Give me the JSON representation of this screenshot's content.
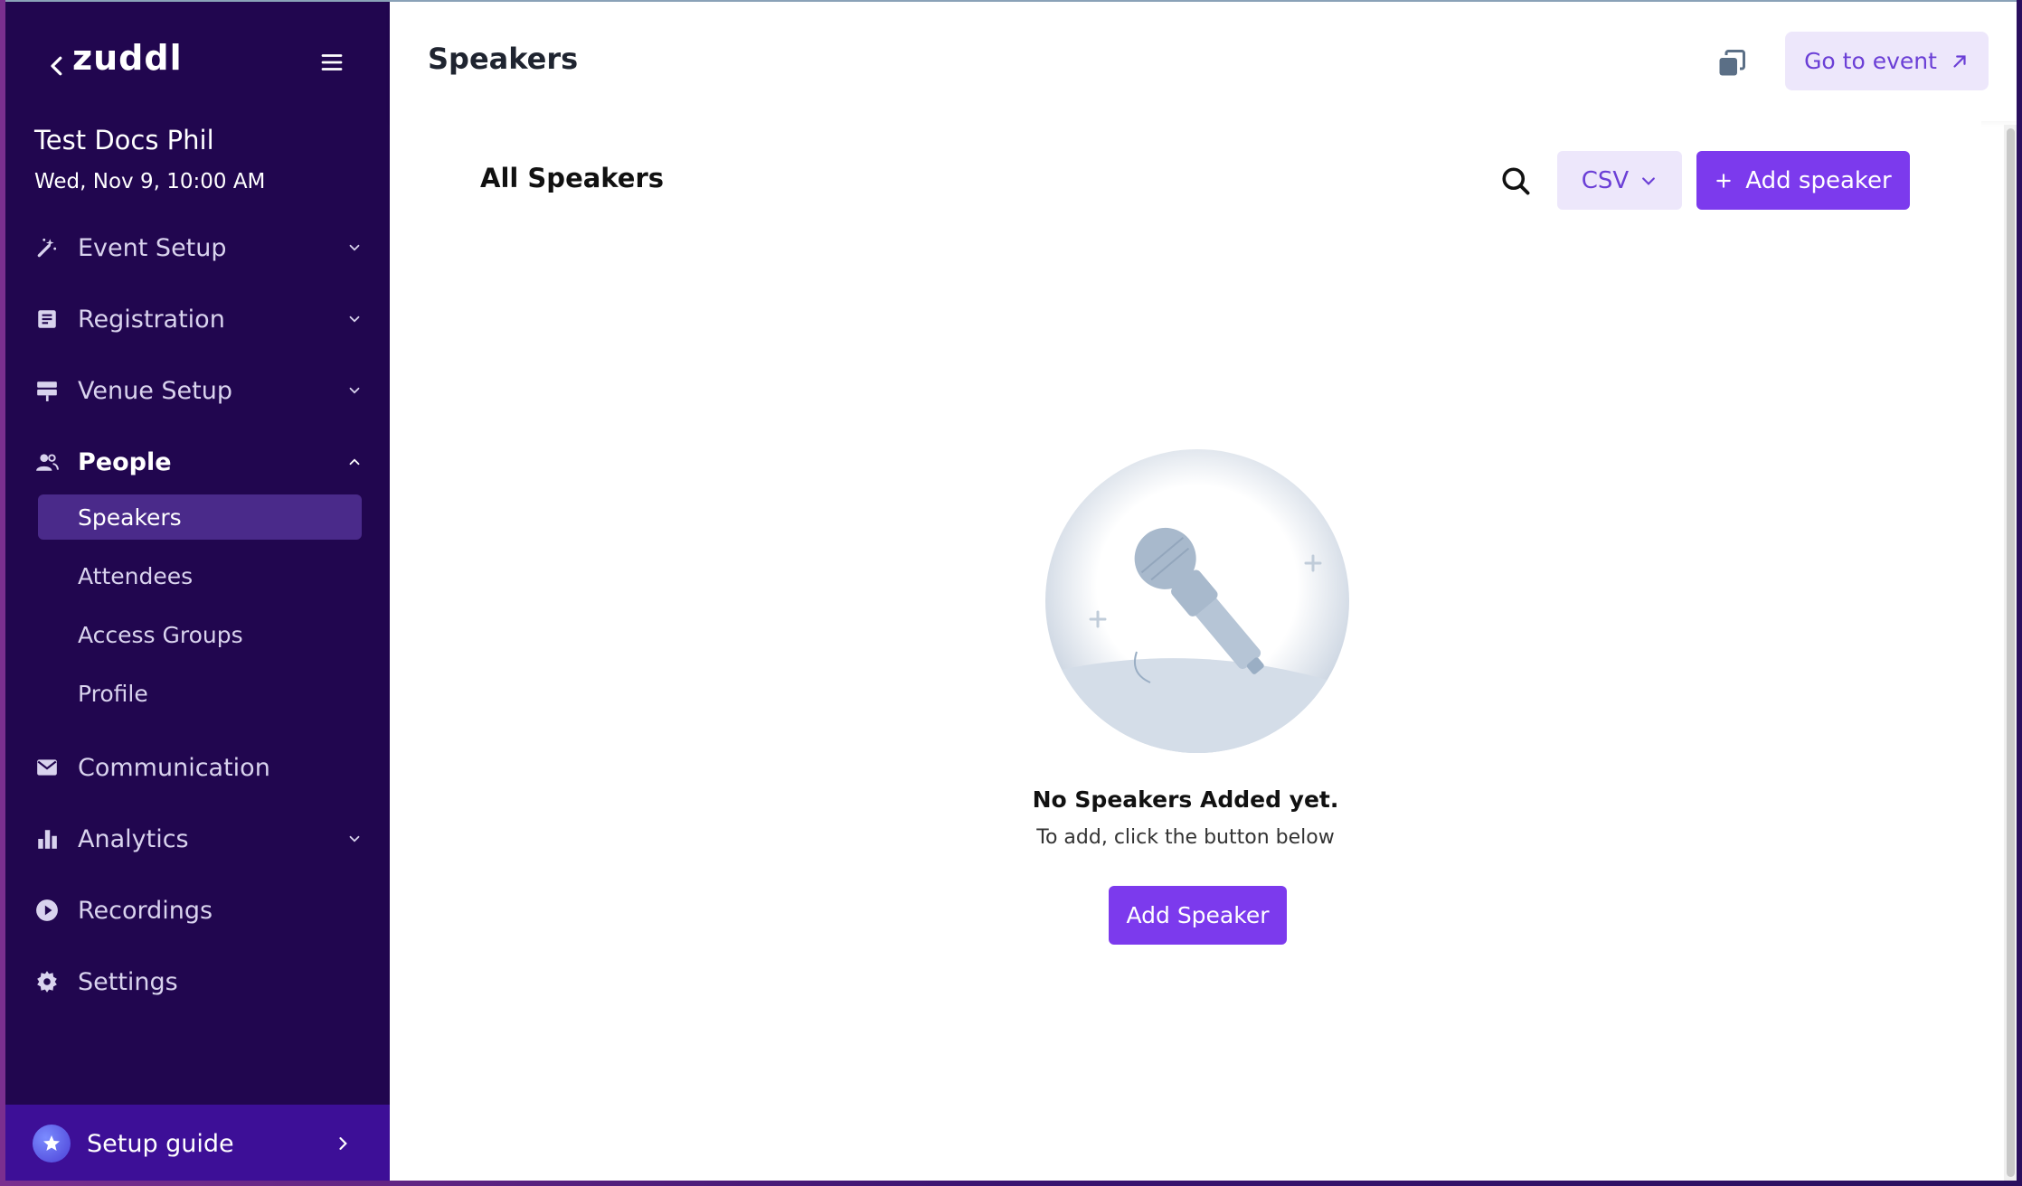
{
  "sidebar": {
    "logo": "zuddl",
    "event_name": "Test Docs Phil",
    "event_date": "Wed, Nov 9, 10:00 AM",
    "nav": [
      {
        "label": "Event Setup",
        "icon": "magic-wand-icon"
      },
      {
        "label": "Registration",
        "icon": "form-icon"
      },
      {
        "label": "Venue Setup",
        "icon": "signpost-icon"
      },
      {
        "label": "People",
        "icon": "people-icon"
      },
      {
        "label": "Communication",
        "icon": "mail-icon"
      },
      {
        "label": "Analytics",
        "icon": "bar-chart-icon"
      },
      {
        "label": "Recordings",
        "icon": "play-circle-icon"
      },
      {
        "label": "Settings",
        "icon": "gear-icon"
      }
    ],
    "people_sub": [
      "Speakers",
      "Attendees",
      "Access Groups",
      "Profile"
    ],
    "setup_guide": "Setup guide"
  },
  "header": {
    "title": "Speakers",
    "go_to_event": "Go to event"
  },
  "main": {
    "section_title": "All Speakers",
    "csv_label": "CSV",
    "add_speaker_label": "Add speaker",
    "empty_title": "No Speakers Added yet.",
    "empty_subtitle": "To add, click the button below",
    "empty_button": "Add Speaker"
  },
  "colors": {
    "sidebar_bg": "#21064f",
    "accent": "#7c3aed",
    "accent_light": "#ede7fb"
  }
}
